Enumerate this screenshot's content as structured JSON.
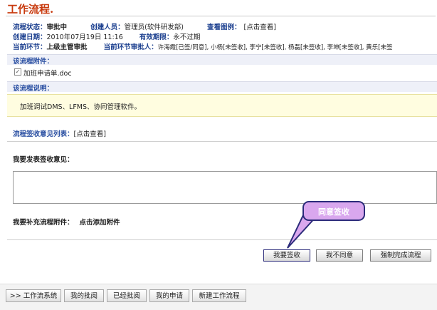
{
  "page": {
    "title": "工作流程."
  },
  "info": {
    "status_label": "流程状态：",
    "status_value": "审批中",
    "creator_label": "创建人员：",
    "creator_value": "管理员(软件研发部)",
    "diagram_label": "查看图例：",
    "diagram_link": "[点击查看]",
    "created_label": "创建日期：",
    "created_value": "2010年07月19日  11:16",
    "valid_label": "有效期限：",
    "valid_value": "永不过期",
    "step_label": "当前环节：",
    "step_value": "上级主管审批",
    "approvers_label": "当前环节审批人：",
    "approvers_value": "许海霞[已签/同意], 小杨[未签收], 李宁[未签收], 杨磊[未签收], 李坤[未签收], 黄乐[未签"
  },
  "attachments": {
    "header": "该流程附件：",
    "file": "加班申请单.doc"
  },
  "description": {
    "header": "该流程说明：",
    "text": "加班调试DMS、LFMS、协同管理软件。"
  },
  "opinions": {
    "label": "流程签收意见列表：",
    "link": "[点击查看]"
  },
  "comment": {
    "label": "我要发表签收意见："
  },
  "extra": {
    "label": "我要补充流程附件：",
    "link": "点击添加附件"
  },
  "callout": {
    "text": "同意签收"
  },
  "buttons": {
    "sign": "我要签收",
    "disagree": "我不同意",
    "force": "强制完成流程"
  },
  "tabs": [
    ">> 工作流系统",
    "我的批阅",
    "已经批阅",
    "我的申请",
    "新建工作流程"
  ]
}
